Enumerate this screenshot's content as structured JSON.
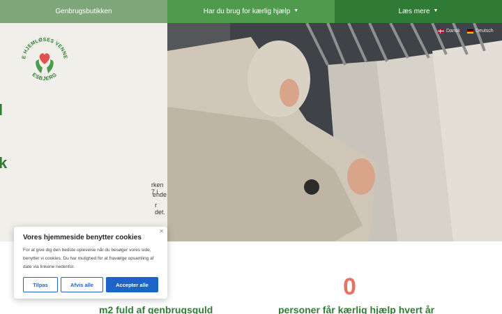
{
  "nav": {
    "items": [
      {
        "label": "Genbrugsbutikken"
      },
      {
        "label": "Har du brug for kærlig hjælp",
        "chevron": "chevron-down-icon"
      },
      {
        "label": "Læs mere",
        "chevron": "chevron-down-icon"
      }
    ],
    "colors": [
      "#7fa67a",
      "#4f9a4c",
      "#2f7a35"
    ]
  },
  "logo": {
    "arc_top": "DE HJEMLØSES VENNER",
    "arc_bottom": "ESBJERG",
    "icon": "hands-heart-logo"
  },
  "hero": {
    "heading_fragment_1": "l",
    "heading_fragment_2": "k",
    "body_fragment_1": "rken 7 i",
    "body_fragment_2": "ende",
    "body_fragment_3": "r det."
  },
  "languages": [
    {
      "label": "Dansk",
      "flag": "denmark-flag-icon"
    },
    {
      "label": "Deutsch",
      "flag": "germany-flag-icon"
    }
  ],
  "stats": [
    {
      "number": "",
      "label": "m2 fuld af genbrugsguld"
    },
    {
      "number": "0",
      "label": "personer får kærlig hjælp hvert år"
    }
  ],
  "cookie": {
    "title": "Vores hjemmeside benytter cookies",
    "text": "For at give dig den bedste oplevelse når du besøger vores side, benytter vi cookies. Du har mulighed for at fravælge opsamling af date via linkene nedenfor.",
    "buttons": {
      "customize": "Tilpas",
      "reject": "Afvis alle",
      "accept": "Accepter alle"
    }
  },
  "colors": {
    "brand_green": "#2e7d32",
    "accent_red": "#e57368",
    "button_blue": "#1e63c7"
  }
}
